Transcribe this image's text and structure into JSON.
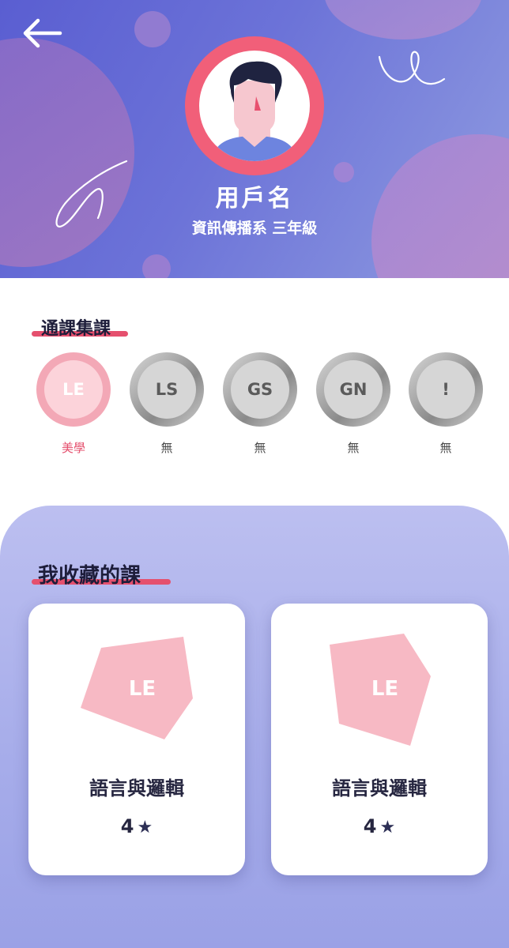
{
  "header": {
    "username": "用戶名",
    "department": "資訊傳播系 三年級",
    "back_icon": "arrow-left-icon",
    "avatar_icon": "user-avatar-icon"
  },
  "general_courses": {
    "title": "通課集課",
    "badges": [
      {
        "code": "LE",
        "label": "美學",
        "active": true
      },
      {
        "code": "LS",
        "label": "無",
        "active": false
      },
      {
        "code": "GS",
        "label": "無",
        "active": false
      },
      {
        "code": "GN",
        "label": "無",
        "active": false
      },
      {
        "code": "!",
        "label": "無",
        "active": false
      }
    ]
  },
  "favorites": {
    "title": "我收藏的課",
    "cards": [
      {
        "code": "LE",
        "name": "語言與邏輯",
        "rating": "4",
        "star_icon": "star-icon"
      },
      {
        "code": "LE",
        "name": "語言與邏輯",
        "rating": "4",
        "star_icon": "star-icon"
      }
    ]
  },
  "colors": {
    "accent": "#e5506e",
    "header_gradient_start": "#5a5ed1",
    "badge_active": "#f3a8b6",
    "card_shape": "#f7b9c4"
  }
}
